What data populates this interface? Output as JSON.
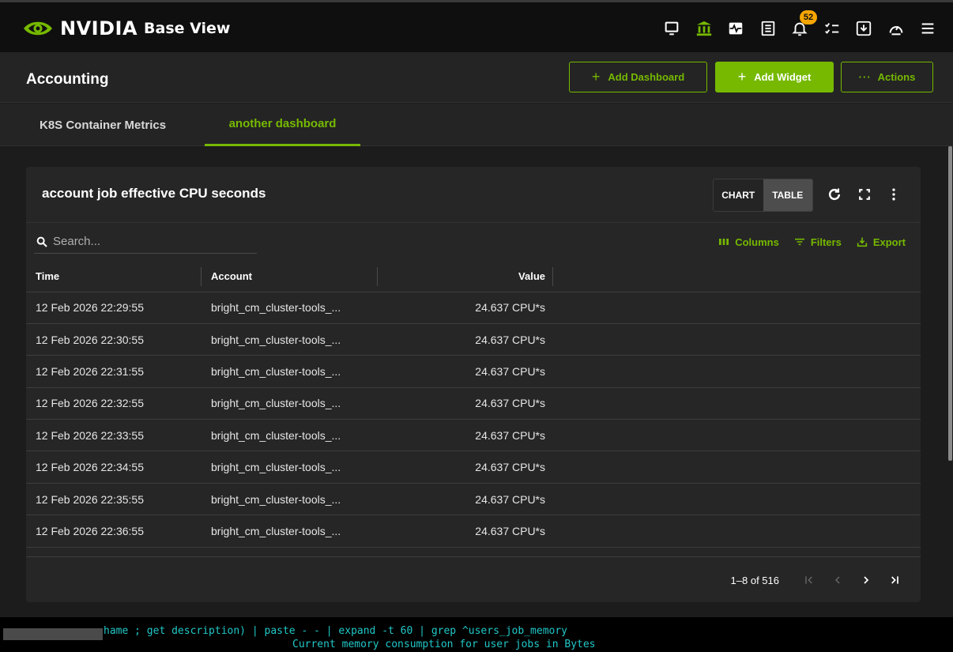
{
  "topbar": {
    "brand": {
      "name": "NVIDIA",
      "product": "Base View"
    },
    "icons": [
      {
        "name": "monitor-icon",
        "active": false
      },
      {
        "name": "bank-icon",
        "active": true
      },
      {
        "name": "heartbeat-icon",
        "active": false
      },
      {
        "name": "list-icon",
        "active": false
      },
      {
        "name": "bell-icon",
        "active": false,
        "badge": "52"
      },
      {
        "name": "checklist-icon",
        "active": false
      },
      {
        "name": "download-icon",
        "active": false
      },
      {
        "name": "gauge-icon",
        "active": false
      },
      {
        "name": "menu-icon",
        "active": false
      }
    ]
  },
  "header": {
    "title": "Accounting",
    "add_dashboard": "Add Dashboard",
    "add_widget": "Add Widget",
    "actions": "Actions"
  },
  "tabs": [
    {
      "label": "K8S Container Metrics",
      "active": false
    },
    {
      "label": "another dashboard",
      "active": true
    }
  ],
  "widget": {
    "title": "account job effective CPU seconds",
    "view_toggle": {
      "chart": "CHART",
      "table": "TABLE",
      "selected": "TABLE"
    },
    "search_placeholder": "Search...",
    "tools": {
      "columns": "Columns",
      "filters": "Filters",
      "export": "Export"
    },
    "columns": [
      "Time",
      "Account",
      "Value"
    ],
    "rows": [
      [
        "12 Feb 2026 22:29:55",
        "bright_cm_cluster-tools_...",
        "24.637 CPU*s"
      ],
      [
        "12 Feb 2026 22:30:55",
        "bright_cm_cluster-tools_...",
        "24.637 CPU*s"
      ],
      [
        "12 Feb 2026 22:31:55",
        "bright_cm_cluster-tools_...",
        "24.637 CPU*s"
      ],
      [
        "12 Feb 2026 22:32:55",
        "bright_cm_cluster-tools_...",
        "24.637 CPU*s"
      ],
      [
        "12 Feb 2026 22:33:55",
        "bright_cm_cluster-tools_...",
        "24.637 CPU*s"
      ],
      [
        "12 Feb 2026 22:34:55",
        "bright_cm_cluster-tools_...",
        "24.637 CPU*s"
      ],
      [
        "12 Feb 2026 22:35:55",
        "bright_cm_cluster-tools_...",
        "24.637 CPU*s"
      ],
      [
        "12 Feb 2026 22:36:55",
        "bright_cm_cluster-tools_...",
        "24.637 CPU*s"
      ]
    ],
    "pagination": {
      "range": "1–8 of 516"
    }
  },
  "terminal": {
    "line1": "hame ; get description) | paste - - | expand -t 60 | grep ^users_job_memory",
    "line2": "Current memory consumption for user jobs in Bytes"
  },
  "colors": {
    "accent": "#76b900",
    "badge": "#f7a600",
    "terminal_text": "#22c7c7"
  }
}
